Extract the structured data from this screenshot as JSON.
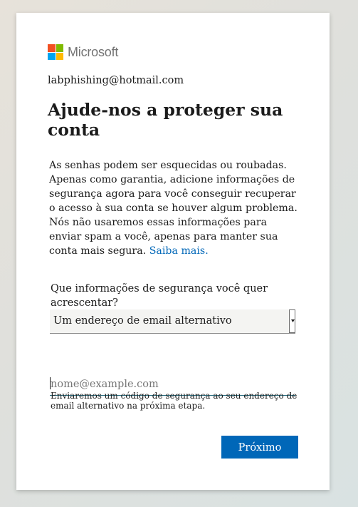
{
  "brand": {
    "logo_text": "Microsoft",
    "logo_colors": [
      "#f25022",
      "#7fba00",
      "#00a4ef",
      "#ffb900"
    ]
  },
  "account": {
    "email": "labphishing@hotmail.com"
  },
  "page": {
    "title": "Ajude-nos a proteger sua conta",
    "description": "As senhas podem ser esquecidas ou roubadas. Apenas como garantia, adicione informações de segurança agora para você conseguir recuperar o acesso à sua conta se houver algum problema. Nós não usaremos essas informações para enviar spam a você, apenas para manter sua conta mais segura.",
    "learn_more_link": "Saiba mais."
  },
  "form": {
    "question_label": "Que informações de segurança você quer acrescentar?",
    "selected_option": "Um endereço de email alternativo",
    "email_placeholder": "nome@example.com",
    "email_value": "",
    "hint": "Enviaremos um código de segurança ao seu endereço de email alternativo na próxima etapa.",
    "next_button": "Próximo"
  },
  "colors": {
    "accent": "#0067b8",
    "input_underline": "#2b6e80"
  },
  "icons": {
    "select_arrow": "chevron-down-icon"
  }
}
